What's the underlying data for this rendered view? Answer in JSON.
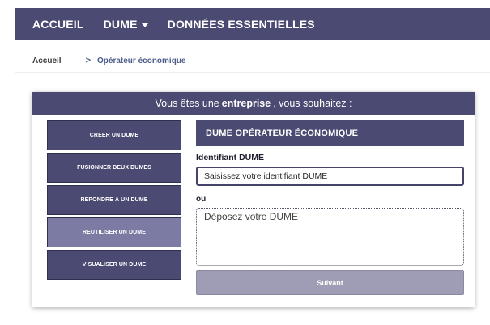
{
  "nav": {
    "items": [
      {
        "label": "ACCUEIL"
      },
      {
        "label": "DUME",
        "has_dropdown": true
      },
      {
        "label": "DONNÉES ESSENTIELLES"
      }
    ]
  },
  "breadcrumb": {
    "home": "Accueil",
    "separator": ">",
    "current": "Opérateur économique"
  },
  "card": {
    "header_prefix": "Vous êtes une",
    "header_strong": "entreprise",
    "header_suffix": ", vous souhaitez :",
    "actions": [
      {
        "label": "CREER UN DUME",
        "active": false
      },
      {
        "label": "FUSIONNER DEUX DUMES",
        "active": false
      },
      {
        "label": "REPONDRE À UN DUME",
        "active": false
      },
      {
        "label": "REUTILISER UN DUME",
        "active": true
      },
      {
        "label": "VISUALISER UN DUME",
        "active": false
      }
    ],
    "panel": {
      "title": "DUME OPÉRATEUR ÉCONOMIQUE",
      "id_label": "Identifiant DUME",
      "id_placeholder": "Saisissez votre identifiant DUME",
      "id_value": "",
      "or_label": "ou",
      "dropzone_text": "Déposez votre DUME",
      "submit_label": "Suivant"
    }
  },
  "colors": {
    "primary": "#4a4a72",
    "active_action": "#7c7ba3",
    "disabled_button": "#9e9db5",
    "breadcrumb_link": "#4a5c8a"
  }
}
